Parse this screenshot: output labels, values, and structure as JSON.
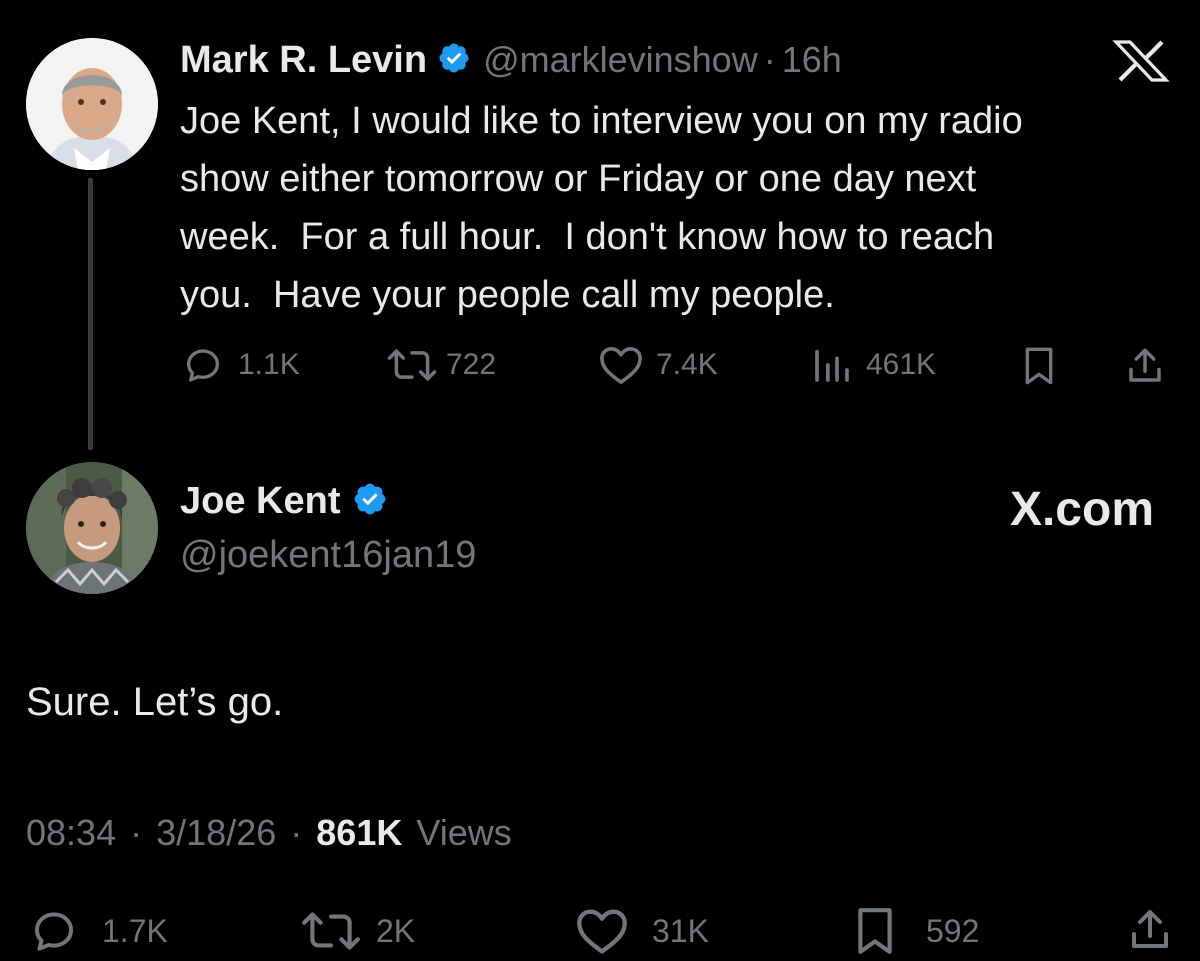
{
  "original_tweet": {
    "author_name": "Mark R. Levin",
    "handle": "@marklevinshow",
    "separator": "·",
    "time": "16h",
    "text": "Joe Kent, I would like to interview you on my radio\nshow either tomorrow or Friday or one day next\nweek.  For a full hour.  I don't know how to reach\nyou.  Have your people call my people.",
    "actions": {
      "replies": "1.1K",
      "reposts": "722",
      "likes": "7.4K",
      "views": "461K"
    },
    "icons": [
      "x-logo-icon",
      "verified-badge-icon",
      "reply-icon",
      "repost-icon",
      "like-icon",
      "views-icon",
      "bookmark-icon",
      "share-icon"
    ]
  },
  "reply_tweet": {
    "author_name": "Joe Kent",
    "handle": "@joekent16jan19",
    "watermark": "X.com",
    "text": "Sure. Let’s go.",
    "time": "08:34",
    "date": "3/18/26",
    "separator": "·",
    "views_count": "861K",
    "views_label": "Views",
    "actions": {
      "replies": "1.7K",
      "reposts": "2K",
      "likes": "31K",
      "bookmarks": "592"
    }
  },
  "colors": {
    "background": "#000000",
    "text_primary": "#e7e9ea",
    "text_secondary": "#71767b",
    "verified_blue": "#1d9bf0"
  }
}
